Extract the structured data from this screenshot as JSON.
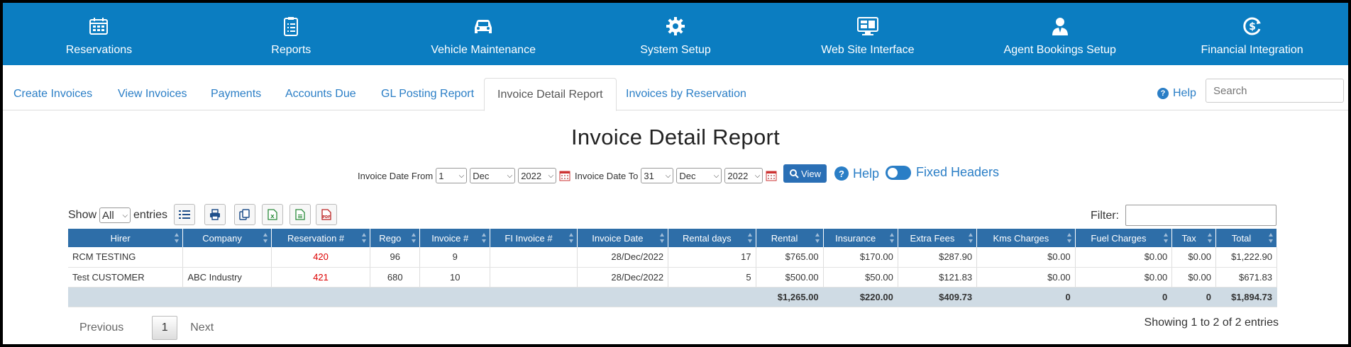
{
  "topnav": {
    "items": [
      {
        "label": "Reservations",
        "icon": "calendar-icon"
      },
      {
        "label": "Reports",
        "icon": "clipboard-icon"
      },
      {
        "label": "Vehicle Maintenance",
        "icon": "car-icon"
      },
      {
        "label": "System Setup",
        "icon": "gear-icon"
      },
      {
        "label": "Web Site Interface",
        "icon": "monitor-icon"
      },
      {
        "label": "Agent Bookings Setup",
        "icon": "user-icon"
      },
      {
        "label": "Financial Integration",
        "icon": "dollar-cycle-icon"
      }
    ]
  },
  "tabs": {
    "items": [
      "Create Invoices",
      "View Invoices",
      "Payments",
      "Accounts Due",
      "GL Posting Report",
      "Invoice Detail Report",
      "Invoices by Reservation"
    ],
    "active": "Invoice Detail Report",
    "help_label": "Help",
    "search_placeholder": "Search"
  },
  "page_title": "Invoice Detail Report",
  "filters": {
    "from_label": "Invoice Date From",
    "from_day": "1",
    "from_month": "Dec",
    "from_year": "2022",
    "to_label": "Invoice Date To",
    "to_day": "31",
    "to_month": "Dec",
    "to_year": "2022",
    "view_label": "View",
    "help_label": "Help",
    "fixed_headers_label": "Fixed Headers"
  },
  "entries": {
    "show_label": "Show",
    "value": "All",
    "entries_label": "entries",
    "filter_label": "Filter:"
  },
  "table": {
    "headers": [
      "Hirer",
      "Company",
      "Reservation #",
      "Rego",
      "Invoice #",
      "FI Invoice #",
      "Invoice Date",
      "Rental days",
      "Rental",
      "Insurance",
      "Extra Fees",
      "Kms Charges",
      "Fuel Charges",
      "Tax",
      "Total"
    ],
    "rows": [
      [
        "RCM TESTING",
        "",
        "420",
        "96",
        "9",
        "",
        "28/Dec/2022",
        "17",
        "$765.00",
        "$170.00",
        "$287.90",
        "$0.00",
        "$0.00",
        "$0.00",
        "$1,222.90"
      ],
      [
        "Test CUSTOMER",
        "ABC Industry",
        "421",
        "680",
        "10",
        "",
        "28/Dec/2022",
        "5",
        "$500.00",
        "$50.00",
        "$121.83",
        "$0.00",
        "$0.00",
        "$0.00",
        "$671.83"
      ]
    ],
    "footer": [
      "",
      "",
      "",
      "",
      "",
      "",
      "",
      "",
      "$1,265.00",
      "$220.00",
      "$409.73",
      "0",
      "0",
      "0",
      "$1,894.73"
    ]
  },
  "pager": {
    "previous": "Previous",
    "page": "1",
    "next": "Next",
    "info": "Showing 1 to 2 of 2 entries"
  }
}
